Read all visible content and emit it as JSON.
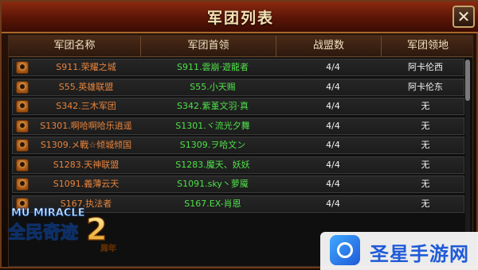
{
  "window": {
    "title": "军团列表",
    "close_symbol": "✕"
  },
  "table": {
    "columns": [
      "军团名称",
      "军团首领",
      "战盟数",
      "军团领地"
    ],
    "rows": [
      {
        "name": "S911.荣耀之城",
        "leader": "S911.雲崩·遊龍者",
        "count": "4/4",
        "territory": "阿卡伦西"
      },
      {
        "name": "S55.英雄联盟",
        "leader": "S55.小天赐",
        "count": "4/4",
        "territory": "阿卡伦东"
      },
      {
        "name": "S342.三木军团",
        "leader": "S342.紫堇文羽·真",
        "count": "4/4",
        "territory": "无"
      },
      {
        "name": "S1301.啊哈啊哈乐逍遥",
        "leader": "S1301.ヾ流光夕舞",
        "count": "4/4",
        "territory": "无"
      },
      {
        "name": "S1309.メ戰☆倾城倾国",
        "leader": "S1309.ヲ哈文ン",
        "count": "4/4",
        "territory": "无"
      },
      {
        "name": "S1283.天神联盟",
        "leader": "S1283.魔天、妖妖",
        "count": "4/4",
        "territory": "无"
      },
      {
        "name": "S1091.義薄云天",
        "leader": "S1091.sky丶萝魇",
        "count": "4/4",
        "territory": "无"
      },
      {
        "name": "S167.执法者",
        "leader": "S167.EX-肖恩",
        "count": "4/4",
        "territory": "无"
      }
    ]
  },
  "logo": {
    "top": "MU MIRACLE",
    "main": "全民奇迹",
    "num": "2",
    "tag": "周年"
  },
  "watermark": {
    "text": "圣星手游网"
  },
  "colors": {
    "name": "#e8843c",
    "leader": "#4fe04a",
    "title": "#f6e3b4"
  }
}
